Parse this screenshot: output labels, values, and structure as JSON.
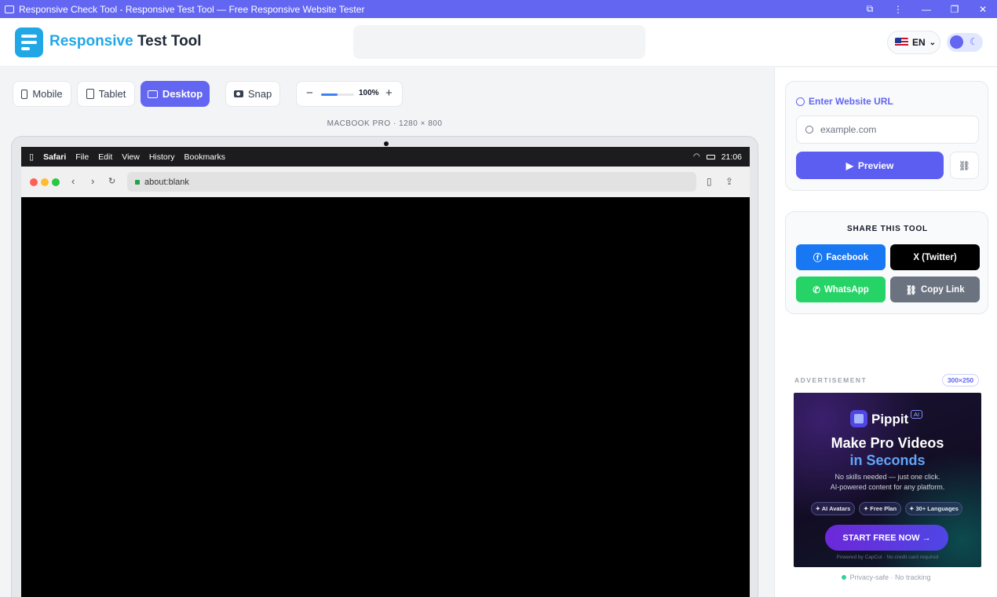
{
  "window": {
    "title": "Responsive Check Tool - Responsive Test Tool — Free Responsive Website Tester",
    "controls": [
      "⧉",
      "⋮",
      "—",
      "❐",
      "✕"
    ]
  },
  "header": {
    "logo_part1": "Responsive",
    "logo_part2": "Test Tool",
    "language": "EN",
    "brand_color": "#22a7e6",
    "accent_color": "#6366f1"
  },
  "toolbar": {
    "mobile_label": "Mobile",
    "tablet_label": "Tablet",
    "desktop_label": "Desktop",
    "snap_label": "Snap",
    "zoom_minus": "−",
    "zoom_plus": "+",
    "zoom_value": "100%",
    "zoom_fraction": 0.5,
    "active_device": "Desktop"
  },
  "device_label": "MACBOOK PRO · 1280 × 800",
  "mac_menubar": {
    "apple": "",
    "items": [
      "Safari",
      "File",
      "Edit",
      "View",
      "History",
      "Bookmarks"
    ],
    "time": "21:06"
  },
  "browser": {
    "address": "about:blank"
  },
  "url_card": {
    "title": "Enter Website URL",
    "placeholder": "example.com",
    "preview_label": "Preview"
  },
  "share_card": {
    "title": "SHARE THIS TOOL",
    "facebook": "Facebook",
    "twitter": "X (Twitter)",
    "whatsapp": "WhatsApp",
    "copy_link": "Copy Link",
    "colors": {
      "facebook": "#1877f2",
      "twitter": "#000000",
      "whatsapp": "#25d366",
      "copy_link": "#6b7280"
    }
  },
  "ad": {
    "label": "ADVERTISEMENT",
    "size": "300×250",
    "brand": "Pippit",
    "badge": "AI",
    "headline1": "Make Pro Videos",
    "headline2": "in Seconds",
    "sub1": "No skills needed — just one click.",
    "sub2": "AI-powered content for any platform.",
    "pills": [
      "✦ AI Avatars",
      "✦ Free Plan",
      "✦ 30+ Languages"
    ],
    "cta": "START FREE NOW →",
    "footer": "Powered by CapCut · No credit card required",
    "privacy": "Privacy-safe · No tracking"
  }
}
